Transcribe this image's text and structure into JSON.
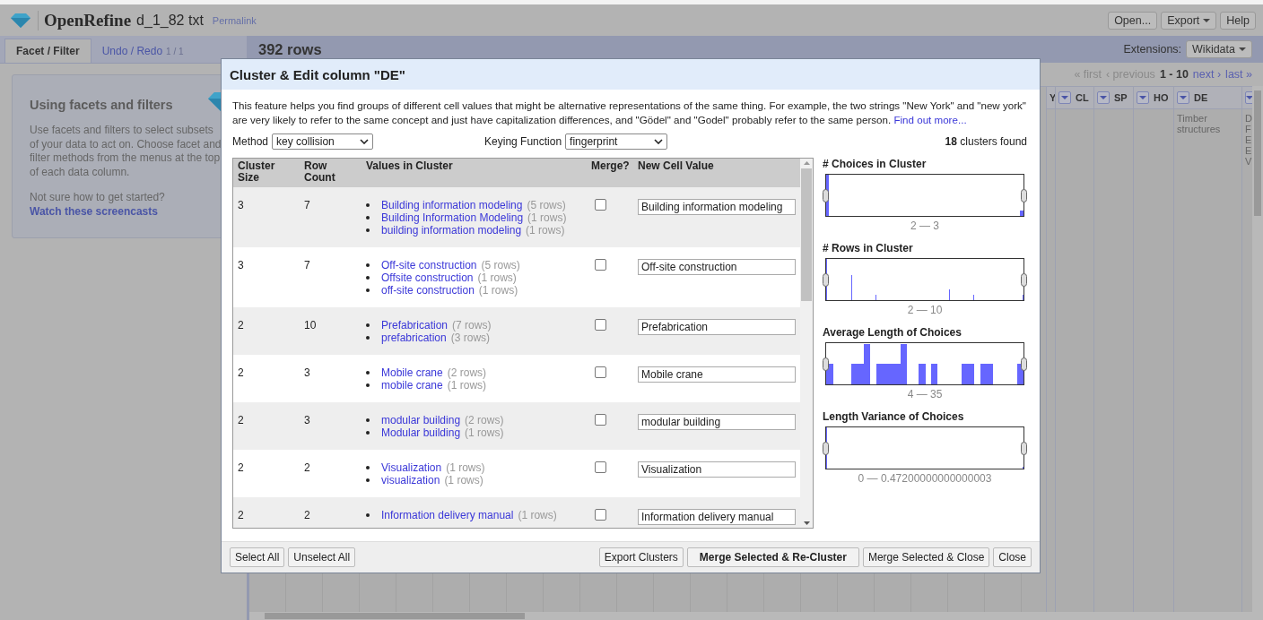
{
  "app": {
    "name": "OpenRefine",
    "project": "d_1_82 txt",
    "permalink": "Permalink",
    "buttons": [
      {
        "label": "Open...",
        "dropdown": false
      },
      {
        "label": "Export",
        "dropdown": true
      },
      {
        "label": "Help",
        "dropdown": false
      }
    ]
  },
  "left_panel": {
    "tabs": [
      {
        "label": "Facet / Filter",
        "selected": true
      },
      {
        "label": "Undo / Redo",
        "count": "1 / 1",
        "selected": false
      }
    ],
    "heading": "Using facets and filters",
    "text": "Use facets and filters to select subsets of your data to act on. Choose facet and filter methods from the menus at the top of each data column.",
    "question": "Not sure how to get started?",
    "link": "Watch these screencasts"
  },
  "grid": {
    "row_count": "392 rows",
    "extensions_label": "Extensions:",
    "extensions_button": "Wikidata",
    "pagination": {
      "first": "« first",
      "previous": "‹ previous",
      "range": "1 - 10",
      "next": "next ›",
      "last": "last »"
    },
    "columns": [
      {
        "label": "Y",
        "menu": false
      },
      {
        "label": "CL",
        "menu": true
      },
      {
        "label": "SP",
        "menu": true
      },
      {
        "label": "HO",
        "menu": true
      },
      {
        "label": "DE",
        "menu": true,
        "cells": [
          "Timber structures"
        ]
      },
      {
        "menu": true,
        "cells": [
          "D F E E V"
        ]
      }
    ]
  },
  "dialog": {
    "title": "Cluster & Edit column \"DE\"",
    "intro": "This feature helps you find groups of different cell values that might be alternative representations of the same thing. For example, the two strings \"New York\" and \"new york\" are very likely to refer to the same concept and just have capitalization differences, and \"Gödel\" and \"Godel\" probably refer to the same person.",
    "intro_link": "Find out more...",
    "method": {
      "label": "Method",
      "value": "key collision"
    },
    "keying": {
      "label": "Keying Function",
      "value": "fingerprint"
    },
    "found": {
      "count": "18",
      "text": "clusters found"
    },
    "columns": [
      "Cluster Size",
      "Row Count",
      "Values in Cluster",
      "Merge?",
      "New Cell Value"
    ],
    "clusters": [
      {
        "size": "3",
        "row_count": "7",
        "merge": false,
        "new_value": "Building information modeling",
        "values": [
          {
            "text": "Building information modeling",
            "rows": "(5 rows)"
          },
          {
            "text": "Building Information Modeling",
            "rows": "(1 rows)"
          },
          {
            "text": "building information modeling",
            "rows": "(1 rows)"
          }
        ]
      },
      {
        "size": "3",
        "row_count": "7",
        "merge": false,
        "new_value": "Off-site construction",
        "values": [
          {
            "text": "Off-site construction",
            "rows": "(5 rows)"
          },
          {
            "text": "Offsite construction",
            "rows": "(1 rows)"
          },
          {
            "text": "off-site construction",
            "rows": "(1 rows)"
          }
        ]
      },
      {
        "size": "2",
        "row_count": "10",
        "merge": false,
        "new_value": "Prefabrication",
        "values": [
          {
            "text": "Prefabrication",
            "rows": "(7 rows)"
          },
          {
            "text": "prefabrication",
            "rows": "(3 rows)"
          }
        ]
      },
      {
        "size": "2",
        "row_count": "3",
        "merge": false,
        "new_value": "Mobile crane",
        "values": [
          {
            "text": "Mobile crane",
            "rows": "(2 rows)"
          },
          {
            "text": "mobile crane",
            "rows": "(1 rows)"
          }
        ]
      },
      {
        "size": "2",
        "row_count": "3",
        "merge": false,
        "new_value": "modular building",
        "values": [
          {
            "text": "modular building",
            "rows": "(2 rows)"
          },
          {
            "text": "Modular building",
            "rows": "(1 rows)"
          }
        ]
      },
      {
        "size": "2",
        "row_count": "2",
        "merge": false,
        "new_value": "Visualization",
        "values": [
          {
            "text": "Visualization",
            "rows": "(1 rows)"
          },
          {
            "text": "visualization",
            "rows": "(1 rows)"
          }
        ]
      },
      {
        "size": "2",
        "row_count": "2",
        "merge": false,
        "new_value": "Information delivery manual",
        "values": [
          {
            "text": "Information delivery manual",
            "rows": "(1 rows)"
          }
        ]
      }
    ],
    "histograms": [
      {
        "title": "# Choices in Cluster",
        "range": "2 — 3"
      },
      {
        "title": "# Rows in Cluster",
        "range": "2 — 10"
      },
      {
        "title": "Average Length of Choices",
        "range": "4 — 35"
      },
      {
        "title": "Length Variance of Choices",
        "range": "0 — 0.47200000000000003"
      }
    ],
    "footer_left": [
      {
        "label": "Select All",
        "kind": "default"
      },
      {
        "label": "Unselect All",
        "kind": "default"
      }
    ],
    "footer_right": [
      {
        "label": "Export Clusters",
        "kind": "default"
      },
      {
        "label": "Merge Selected & Re-Cluster",
        "kind": "primary"
      },
      {
        "label": "Merge Selected & Close",
        "kind": "default"
      },
      {
        "label": "Close",
        "kind": "default"
      }
    ]
  }
}
